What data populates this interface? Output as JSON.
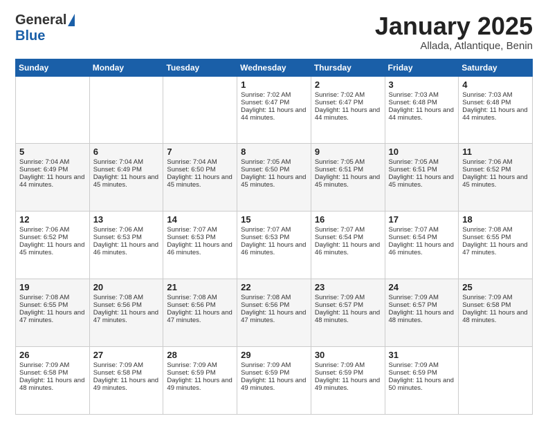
{
  "header": {
    "logo_general": "General",
    "logo_blue": "Blue",
    "title": "January 2025",
    "location": "Allada, Atlantique, Benin"
  },
  "weekdays": [
    "Sunday",
    "Monday",
    "Tuesday",
    "Wednesday",
    "Thursday",
    "Friday",
    "Saturday"
  ],
  "weeks": [
    [
      {
        "day": "",
        "sunrise": "",
        "sunset": "",
        "daylight": ""
      },
      {
        "day": "",
        "sunrise": "",
        "sunset": "",
        "daylight": ""
      },
      {
        "day": "",
        "sunrise": "",
        "sunset": "",
        "daylight": ""
      },
      {
        "day": "1",
        "sunrise": "Sunrise: 7:02 AM",
        "sunset": "Sunset: 6:47 PM",
        "daylight": "Daylight: 11 hours and 44 minutes."
      },
      {
        "day": "2",
        "sunrise": "Sunrise: 7:02 AM",
        "sunset": "Sunset: 6:47 PM",
        "daylight": "Daylight: 11 hours and 44 minutes."
      },
      {
        "day": "3",
        "sunrise": "Sunrise: 7:03 AM",
        "sunset": "Sunset: 6:48 PM",
        "daylight": "Daylight: 11 hours and 44 minutes."
      },
      {
        "day": "4",
        "sunrise": "Sunrise: 7:03 AM",
        "sunset": "Sunset: 6:48 PM",
        "daylight": "Daylight: 11 hours and 44 minutes."
      }
    ],
    [
      {
        "day": "5",
        "sunrise": "Sunrise: 7:04 AM",
        "sunset": "Sunset: 6:49 PM",
        "daylight": "Daylight: 11 hours and 44 minutes."
      },
      {
        "day": "6",
        "sunrise": "Sunrise: 7:04 AM",
        "sunset": "Sunset: 6:49 PM",
        "daylight": "Daylight: 11 hours and 45 minutes."
      },
      {
        "day": "7",
        "sunrise": "Sunrise: 7:04 AM",
        "sunset": "Sunset: 6:50 PM",
        "daylight": "Daylight: 11 hours and 45 minutes."
      },
      {
        "day": "8",
        "sunrise": "Sunrise: 7:05 AM",
        "sunset": "Sunset: 6:50 PM",
        "daylight": "Daylight: 11 hours and 45 minutes."
      },
      {
        "day": "9",
        "sunrise": "Sunrise: 7:05 AM",
        "sunset": "Sunset: 6:51 PM",
        "daylight": "Daylight: 11 hours and 45 minutes."
      },
      {
        "day": "10",
        "sunrise": "Sunrise: 7:05 AM",
        "sunset": "Sunset: 6:51 PM",
        "daylight": "Daylight: 11 hours and 45 minutes."
      },
      {
        "day": "11",
        "sunrise": "Sunrise: 7:06 AM",
        "sunset": "Sunset: 6:52 PM",
        "daylight": "Daylight: 11 hours and 45 minutes."
      }
    ],
    [
      {
        "day": "12",
        "sunrise": "Sunrise: 7:06 AM",
        "sunset": "Sunset: 6:52 PM",
        "daylight": "Daylight: 11 hours and 45 minutes."
      },
      {
        "day": "13",
        "sunrise": "Sunrise: 7:06 AM",
        "sunset": "Sunset: 6:53 PM",
        "daylight": "Daylight: 11 hours and 46 minutes."
      },
      {
        "day": "14",
        "sunrise": "Sunrise: 7:07 AM",
        "sunset": "Sunset: 6:53 PM",
        "daylight": "Daylight: 11 hours and 46 minutes."
      },
      {
        "day": "15",
        "sunrise": "Sunrise: 7:07 AM",
        "sunset": "Sunset: 6:53 PM",
        "daylight": "Daylight: 11 hours and 46 minutes."
      },
      {
        "day": "16",
        "sunrise": "Sunrise: 7:07 AM",
        "sunset": "Sunset: 6:54 PM",
        "daylight": "Daylight: 11 hours and 46 minutes."
      },
      {
        "day": "17",
        "sunrise": "Sunrise: 7:07 AM",
        "sunset": "Sunset: 6:54 PM",
        "daylight": "Daylight: 11 hours and 46 minutes."
      },
      {
        "day": "18",
        "sunrise": "Sunrise: 7:08 AM",
        "sunset": "Sunset: 6:55 PM",
        "daylight": "Daylight: 11 hours and 47 minutes."
      }
    ],
    [
      {
        "day": "19",
        "sunrise": "Sunrise: 7:08 AM",
        "sunset": "Sunset: 6:55 PM",
        "daylight": "Daylight: 11 hours and 47 minutes."
      },
      {
        "day": "20",
        "sunrise": "Sunrise: 7:08 AM",
        "sunset": "Sunset: 6:56 PM",
        "daylight": "Daylight: 11 hours and 47 minutes."
      },
      {
        "day": "21",
        "sunrise": "Sunrise: 7:08 AM",
        "sunset": "Sunset: 6:56 PM",
        "daylight": "Daylight: 11 hours and 47 minutes."
      },
      {
        "day": "22",
        "sunrise": "Sunrise: 7:08 AM",
        "sunset": "Sunset: 6:56 PM",
        "daylight": "Daylight: 11 hours and 47 minutes."
      },
      {
        "day": "23",
        "sunrise": "Sunrise: 7:09 AM",
        "sunset": "Sunset: 6:57 PM",
        "daylight": "Daylight: 11 hours and 48 minutes."
      },
      {
        "day": "24",
        "sunrise": "Sunrise: 7:09 AM",
        "sunset": "Sunset: 6:57 PM",
        "daylight": "Daylight: 11 hours and 48 minutes."
      },
      {
        "day": "25",
        "sunrise": "Sunrise: 7:09 AM",
        "sunset": "Sunset: 6:58 PM",
        "daylight": "Daylight: 11 hours and 48 minutes."
      }
    ],
    [
      {
        "day": "26",
        "sunrise": "Sunrise: 7:09 AM",
        "sunset": "Sunset: 6:58 PM",
        "daylight": "Daylight: 11 hours and 48 minutes."
      },
      {
        "day": "27",
        "sunrise": "Sunrise: 7:09 AM",
        "sunset": "Sunset: 6:58 PM",
        "daylight": "Daylight: 11 hours and 49 minutes."
      },
      {
        "day": "28",
        "sunrise": "Sunrise: 7:09 AM",
        "sunset": "Sunset: 6:59 PM",
        "daylight": "Daylight: 11 hours and 49 minutes."
      },
      {
        "day": "29",
        "sunrise": "Sunrise: 7:09 AM",
        "sunset": "Sunset: 6:59 PM",
        "daylight": "Daylight: 11 hours and 49 minutes."
      },
      {
        "day": "30",
        "sunrise": "Sunrise: 7:09 AM",
        "sunset": "Sunset: 6:59 PM",
        "daylight": "Daylight: 11 hours and 49 minutes."
      },
      {
        "day": "31",
        "sunrise": "Sunrise: 7:09 AM",
        "sunset": "Sunset: 6:59 PM",
        "daylight": "Daylight: 11 hours and 50 minutes."
      },
      {
        "day": "",
        "sunrise": "",
        "sunset": "",
        "daylight": ""
      }
    ]
  ]
}
